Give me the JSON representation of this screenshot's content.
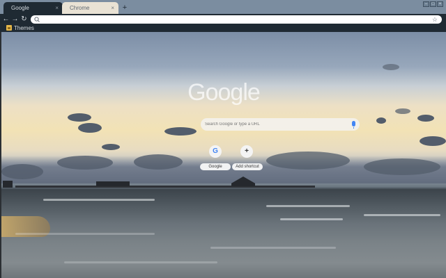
{
  "tabs": [
    {
      "label": "Google",
      "active": true
    },
    {
      "label": "Chrome",
      "active": false
    }
  ],
  "tab_close_glyph": "×",
  "new_tab_glyph": "+",
  "window_controls": [
    "–",
    "□",
    "×"
  ],
  "toolbar": {
    "back_glyph": "←",
    "forward_glyph": "→",
    "reload_glyph": "↻",
    "address_value": "",
    "star_glyph": "☆"
  },
  "bookmarks": [
    {
      "label": "Themes",
      "icon": "apps-icon"
    }
  ],
  "ntp": {
    "logo": "Google",
    "search_placeholder": "Search Google or type a URL",
    "shortcuts": [
      {
        "label": "Google",
        "icon_glyph": "G",
        "icon": "google-g-icon"
      },
      {
        "label": "Add shortcut",
        "icon_glyph": "+",
        "icon": "plus-icon"
      }
    ]
  },
  "colors": {
    "tab_active": "#1f2a33",
    "tab_inactive": "#e9e2d4",
    "frame": "#7b8da0",
    "accent_blue": "#4285f4"
  }
}
